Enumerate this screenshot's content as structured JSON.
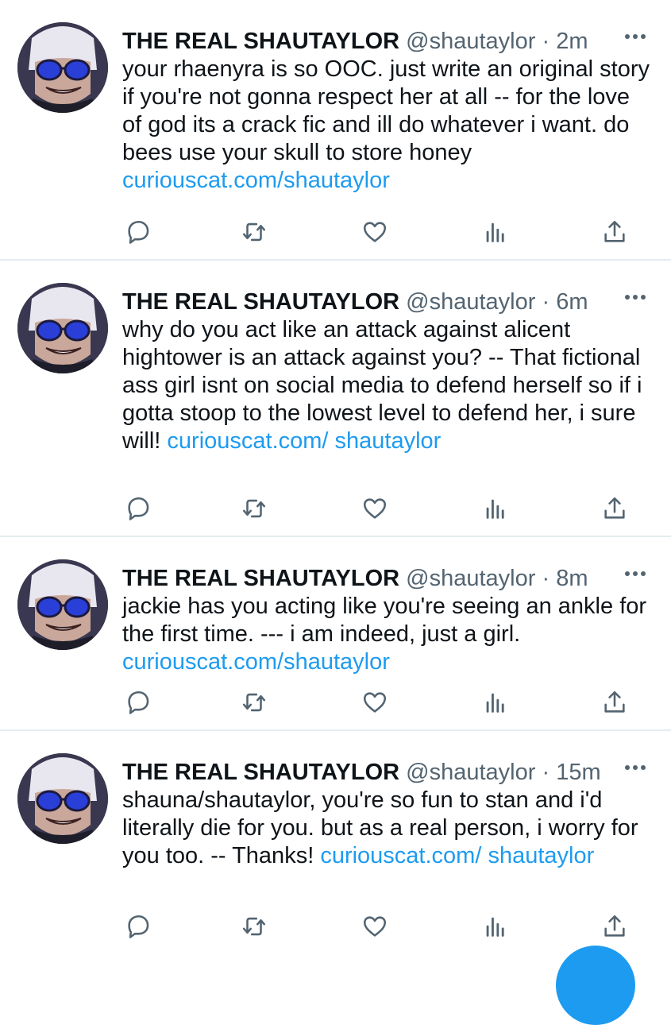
{
  "colors": {
    "link": "#1d9bf0",
    "text": "#0f1419",
    "secondary": "#536471",
    "divider": "#e6ecf0"
  },
  "icons": [
    "reply-icon",
    "retweet-icon",
    "like-icon",
    "analytics-icon",
    "share-icon",
    "more-icon"
  ],
  "tweets": [
    {
      "name": "THE REAL SHAUTAYLOR",
      "handle": "@shautaylor",
      "sep": "·",
      "time": "2m",
      "text": "your rhaenyra is so OOC. just write an original story if you're not gonna respect her at all -- for the love of god its a crack fic and ill do whatever i want. do bees use your skull to store honey",
      "link": "curiouscat.com/shautaylor"
    },
    {
      "name": "THE REAL SHAUTAYLOR",
      "handle": "@shautaylor",
      "sep": "·",
      "time": "6m",
      "text": "why do you act like an attack against alicent hightower is an attack against you? -- That fictional ass girl isnt on social media to defend herself so if i gotta stoop to the lowest level to defend her, i sure will!",
      "link": "curiouscat.com/ shautaylor"
    },
    {
      "name": "THE REAL SHAUTAYLOR",
      "handle": "@shautaylor",
      "sep": "·",
      "time": "8m",
      "text": "jackie has you acting like you're seeing an ankle for the first time. --- i am indeed, just a girl.",
      "link": "curiouscat.com/shautaylor"
    },
    {
      "name": "THE REAL SHAUTAYLOR",
      "handle": "@shautaylor",
      "sep": "·",
      "time": "15m",
      "text": "shauna/shautaylor, you're so fun to stan and i'd literally die for you. but as a real person, i worry for you too. -- Thanks!",
      "link": "curiouscat.com/ shautaylor"
    }
  ]
}
